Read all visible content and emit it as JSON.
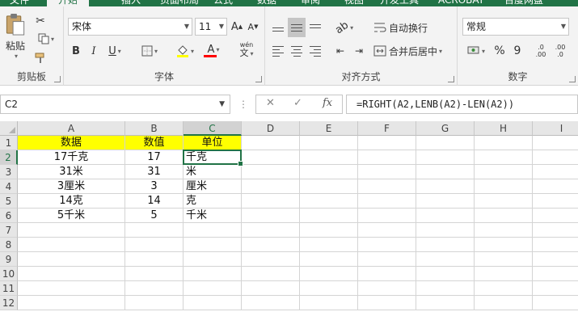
{
  "tabs": {
    "items": [
      "文件",
      "开始",
      "插入",
      "页面布局",
      "公式",
      "数据",
      "审阅",
      "视图",
      "开发工具",
      "ACROBAT",
      "百度网盘"
    ],
    "active_index": 1
  },
  "ribbon": {
    "clipboard": {
      "label": "剪贴板",
      "paste_label": "粘贴"
    },
    "font": {
      "label": "字体",
      "font_name": "宋体",
      "font_size": "11",
      "bold": "B",
      "italic": "I",
      "underline": "U",
      "grow": "A",
      "shrink": "A",
      "font_color_glyph": "A",
      "phonetic": "wén"
    },
    "alignment": {
      "label": "对齐方式",
      "wrap_text": "自动换行",
      "merge_center": "合并后居中"
    },
    "number": {
      "label": "数字",
      "format": "常规",
      "percent": "%",
      "comma": "9",
      "inc_decimal": ".00",
      "dec_decimal": ".0"
    }
  },
  "formula_bar": {
    "name_box": "C2",
    "fx": "fx",
    "formula": "=RIGHT(A2,LENB(A2)-LEN(A2))"
  },
  "sheet": {
    "columns": [
      "A",
      "B",
      "C",
      "D",
      "E",
      "F",
      "G",
      "H",
      "I"
    ],
    "row_numbers": [
      "1",
      "2",
      "3",
      "4",
      "5",
      "6",
      "7",
      "8",
      "9",
      "10",
      "11",
      "12"
    ],
    "active_column": "C",
    "active_row": "2",
    "header_fill": "#ffff00",
    "accent": "#217346",
    "rows": [
      [
        "数据",
        "数值",
        "单位"
      ],
      [
        "17千克",
        "17",
        "千克"
      ],
      [
        "31米",
        "31",
        "米"
      ],
      [
        "3厘米",
        "3",
        "厘米"
      ],
      [
        "14克",
        "14",
        "克"
      ],
      [
        "5千米",
        "5",
        "千米"
      ]
    ]
  }
}
